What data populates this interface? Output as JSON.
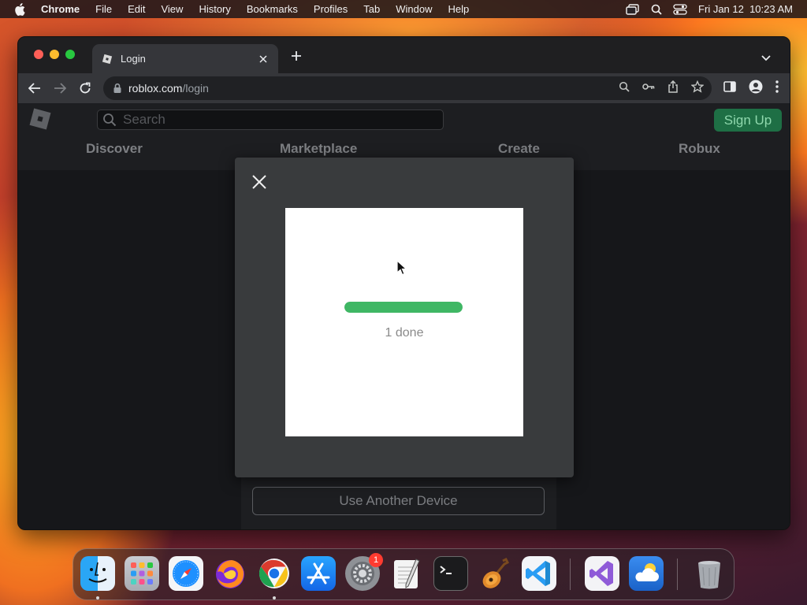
{
  "menubar": {
    "app_name": "Chrome",
    "items": [
      "File",
      "Edit",
      "View",
      "History",
      "Bookmarks",
      "Profiles",
      "Tab",
      "Window",
      "Help"
    ],
    "clock": "Fri Jan 12  10:23 AM"
  },
  "browser": {
    "tab_title": "Login",
    "url_host": "roblox.com",
    "url_path": "/login"
  },
  "site": {
    "search_placeholder": "Search",
    "signup_label": "Sign Up",
    "nav": [
      "Discover",
      "Marketplace",
      "Create",
      "Robux"
    ],
    "another_device_label": "Use Another Device"
  },
  "modal": {
    "progress_fraction": 1.0,
    "status_text": "1 done"
  },
  "dock": {
    "icons": [
      "finder-icon",
      "launchpad-icon",
      "safari-icon",
      "firefox-icon",
      "chrome-icon",
      "app-store-icon",
      "system-settings-icon",
      "textedit-icon",
      "terminal-icon",
      "garageband-icon",
      "vscode-icon",
      "visual-studio-icon",
      "weather-icon",
      "trash-icon"
    ],
    "settings_badge": "1"
  },
  "colors": {
    "progress": "#3fb764",
    "signup_bg": "#1e6f45",
    "modal_bg": "#393b3d"
  }
}
